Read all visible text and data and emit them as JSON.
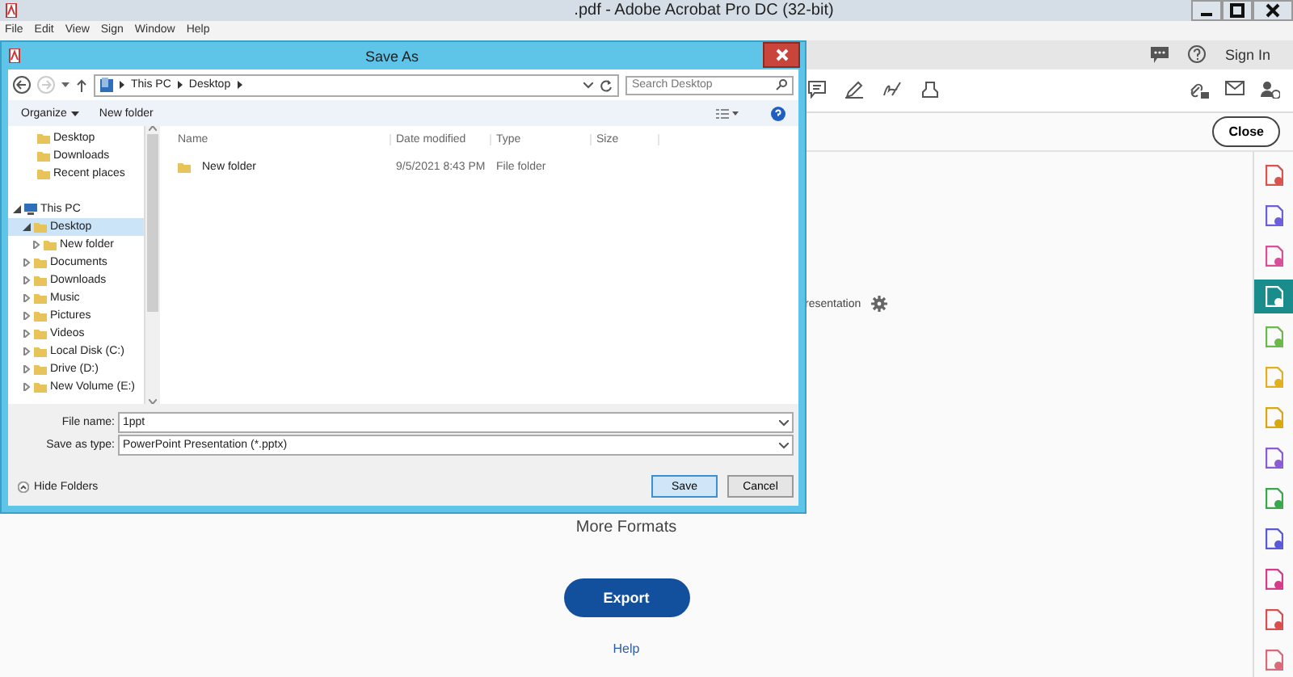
{
  "app": {
    "title": ".pdf - Adobe Acrobat Pro DC (32-bit)",
    "menu": [
      "File",
      "Edit",
      "View",
      "Sign",
      "Window",
      "Help"
    ],
    "sign_in": "Sign In",
    "close": "Close",
    "partial_label": "resentation",
    "more_formats": "More Formats",
    "export": "Export",
    "help": "Help",
    "tools": [
      {
        "color": "#d9534f",
        "selected": false
      },
      {
        "color": "#6c5fd9",
        "selected": false
      },
      {
        "color": "#d94f9a",
        "selected": false
      },
      {
        "color": "#1b8c8c",
        "selected": true
      },
      {
        "color": "#6cb84a",
        "selected": false
      },
      {
        "color": "#e0b020",
        "selected": false
      },
      {
        "color": "#d9a810",
        "selected": false
      },
      {
        "color": "#8a5cd6",
        "selected": false
      },
      {
        "color": "#3aa84a",
        "selected": false
      },
      {
        "color": "#5a5ad6",
        "selected": false
      },
      {
        "color": "#d63a8a",
        "selected": false
      },
      {
        "color": "#d94f4f",
        "selected": false
      },
      {
        "color": "#d96a7a",
        "selected": false
      }
    ]
  },
  "dialog": {
    "title": "Save As",
    "breadcrumb": [
      "This PC",
      "Desktop"
    ],
    "search": {
      "placeholder": "Search Desktop"
    },
    "commands": {
      "organize": "Organize",
      "new_folder": "New folder"
    },
    "favorites": [
      {
        "label": "Desktop",
        "selected": false
      },
      {
        "label": "Downloads",
        "selected": false
      },
      {
        "label": "Recent places",
        "selected": false
      }
    ],
    "tree": [
      {
        "label": "This PC",
        "expanded": true,
        "selected": false,
        "children": [
          {
            "label": "Desktop",
            "expanded": true,
            "selected": true,
            "children": [
              {
                "label": "New folder",
                "expanded": false,
                "selected": false
              }
            ]
          },
          {
            "label": "Documents",
            "expanded": false,
            "selected": false
          },
          {
            "label": "Downloads",
            "expanded": false,
            "selected": false
          },
          {
            "label": "Music",
            "expanded": false,
            "selected": false
          },
          {
            "label": "Pictures",
            "expanded": false,
            "selected": false
          },
          {
            "label": "Videos",
            "expanded": false,
            "selected": false
          },
          {
            "label": "Local Disk (C:)",
            "expanded": false,
            "selected": false
          },
          {
            "label": "Drive (D:)",
            "expanded": false,
            "selected": false
          },
          {
            "label": "New Volume (E:)",
            "expanded": false,
            "selected": false
          }
        ]
      }
    ],
    "columns": [
      "Name",
      "Date modified",
      "Type",
      "Size"
    ],
    "rows": [
      {
        "name": "New folder",
        "date": "9/5/2021 8:43 PM",
        "type": "File folder"
      }
    ],
    "file_name": {
      "label": "File name:",
      "value": "1ppt"
    },
    "save_type": {
      "label": "Save as type:",
      "value": "PowerPoint Presentation (*.pptx)"
    },
    "hide_folders": "Hide Folders",
    "buttons": {
      "save": "Save",
      "cancel": "Cancel"
    }
  }
}
